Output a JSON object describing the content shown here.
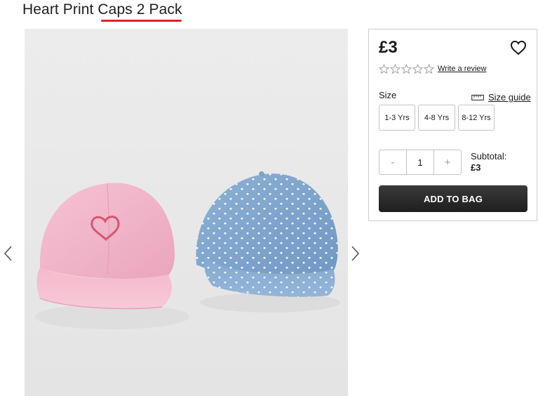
{
  "product": {
    "title_part1": "Heart Print ",
    "title_part2": "Caps 2 Pack",
    "accent_color": "#e1202e"
  },
  "gallery": {
    "prev_icon": "chevron-left-icon",
    "next_icon": "chevron-right-icon"
  },
  "purchase": {
    "price": "£3",
    "wishlist_icon": "heart-outline-icon",
    "rating": {
      "stars_filled": 0,
      "stars_total": 5,
      "review_link": "Write a review"
    },
    "size_label": "Size",
    "size_guide_label": "Size guide",
    "size_guide_icon": "ruler-icon",
    "sizes": [
      "1-3 Yrs",
      "4-8 Yrs",
      "8-12 Yrs"
    ],
    "quantity": {
      "decrement": "-",
      "value": "1",
      "increment": "+"
    },
    "subtotal_label": "Subtotal:",
    "subtotal_value": "£3",
    "add_to_bag": "ADD TO BAG"
  }
}
